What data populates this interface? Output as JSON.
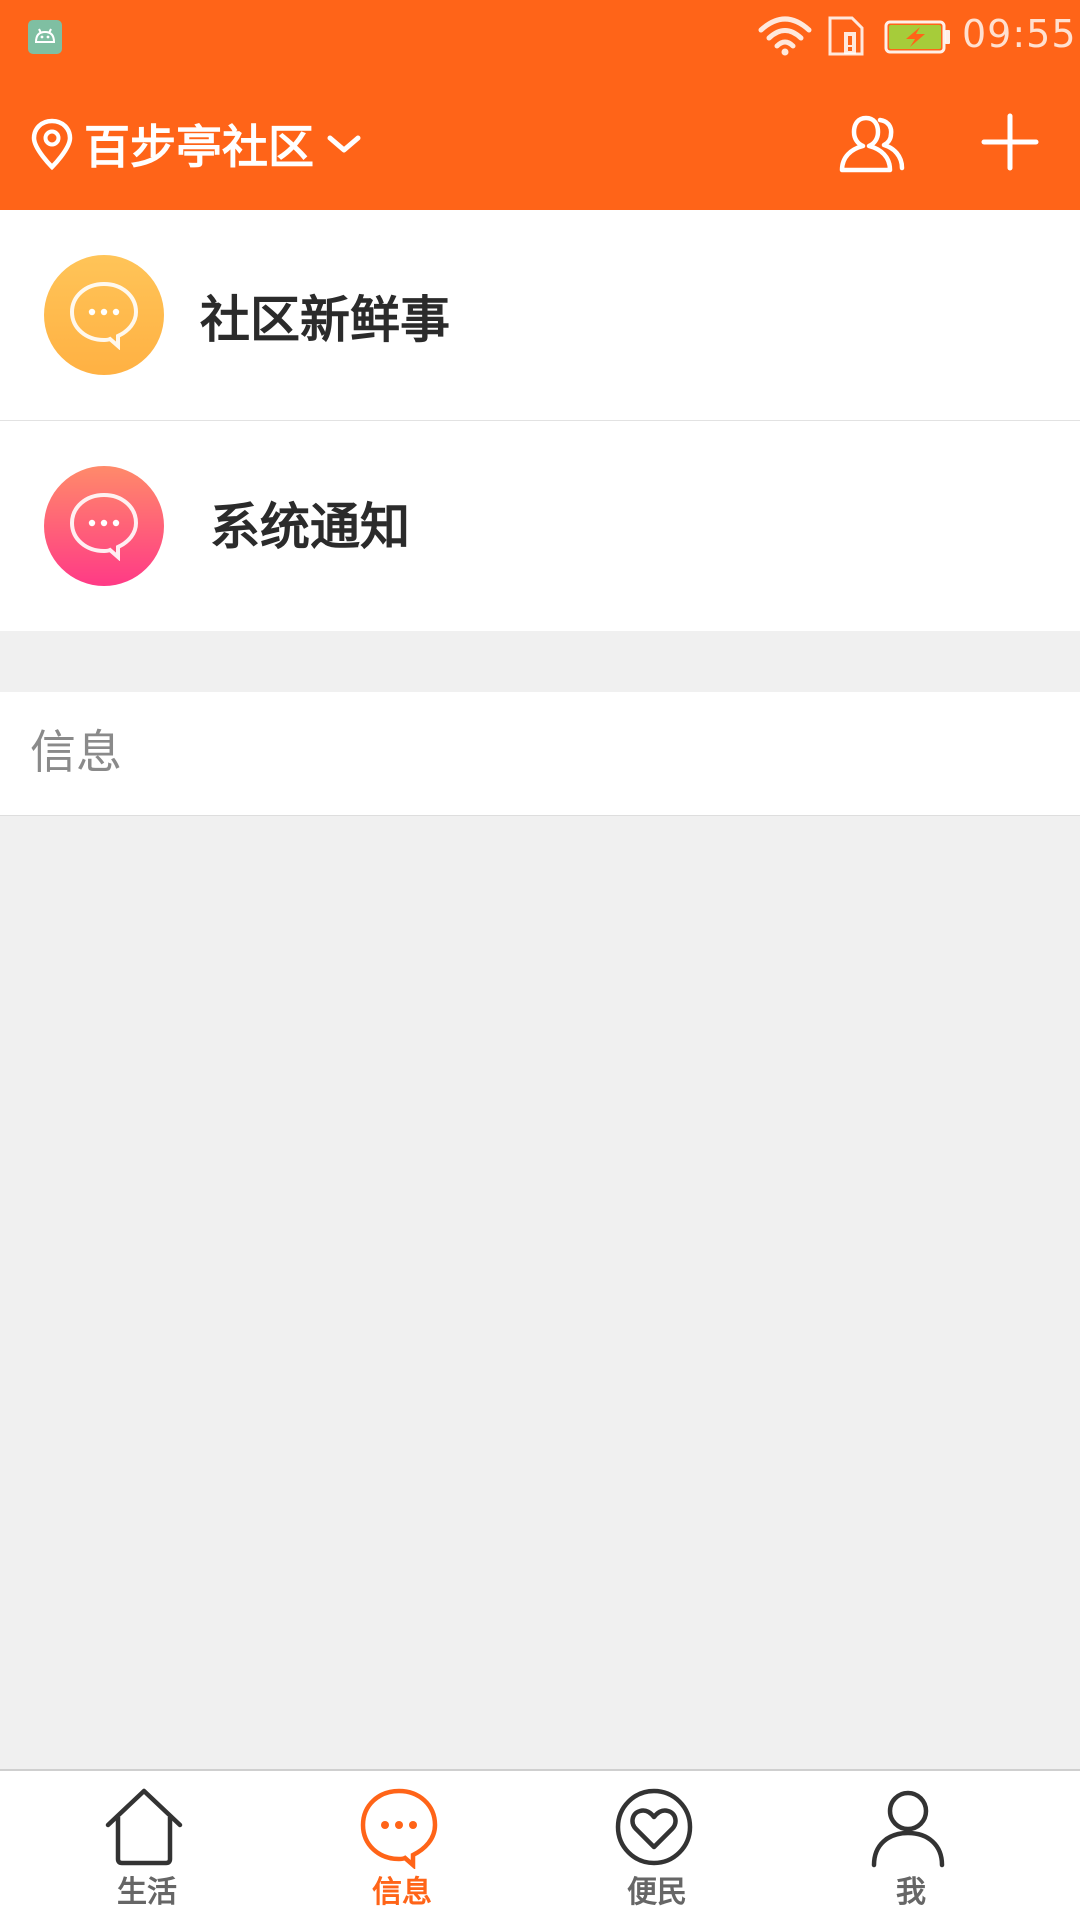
{
  "status_bar": {
    "time": "09:55",
    "icons": [
      "android-debug-icon",
      "wifi-icon",
      "sim-icon",
      "battery-charging-icon"
    ]
  },
  "header": {
    "location": "百步亭社区",
    "icons": [
      "location-pin-icon",
      "chevron-down-icon",
      "contacts-icon",
      "plus-icon"
    ]
  },
  "messages": [
    {
      "title": "社区新鲜事",
      "icon": "chat-bubble-icon",
      "color": "#ffb84c"
    },
    {
      "title": "系统通知",
      "icon": "chat-bubble-icon",
      "color": "#ff5a7a"
    }
  ],
  "section": {
    "title": "信息"
  },
  "bottom_nav": {
    "items": [
      {
        "label": "生活",
        "icon": "home-icon",
        "active": false
      },
      {
        "label": "信息",
        "icon": "chat-bubble-icon",
        "active": true
      },
      {
        "label": "便民",
        "icon": "heart-circle-icon",
        "active": false
      },
      {
        "label": "我",
        "icon": "user-icon",
        "active": false
      }
    ]
  },
  "colors": {
    "primary": "#ff6418",
    "background": "#f0f0f0",
    "text_dark": "#2b2b2b",
    "text_muted": "#8a8a8a"
  }
}
